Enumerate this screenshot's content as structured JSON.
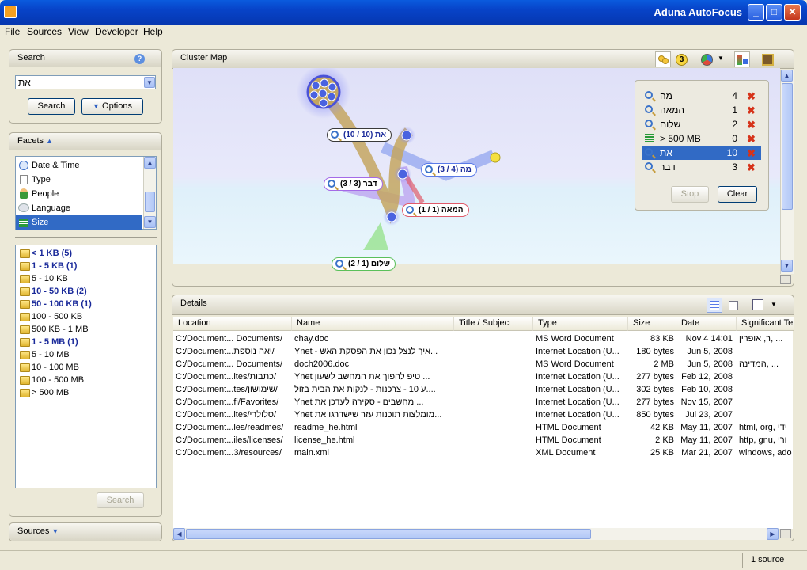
{
  "window": {
    "title": "Aduna AutoFocus",
    "min": "_",
    "max": "□",
    "close": "✕"
  },
  "menu": [
    "File",
    "Sources",
    "View",
    "Developer",
    "Help"
  ],
  "search": {
    "title": "Search",
    "value": "את",
    "search_btn": "Search",
    "options_btn": "Options"
  },
  "facets": {
    "title": "Facets",
    "items": [
      "Date & Time",
      "Type",
      "People",
      "Language",
      "Size"
    ],
    "selected": "Size",
    "values": [
      {
        "label": "< 1 KB  (5)",
        "bold": true
      },
      {
        "label": "1 - 5 KB  (1)",
        "bold": true
      },
      {
        "label": "5 - 10 KB",
        "bold": false
      },
      {
        "label": "10 - 50 KB  (2)",
        "bold": true
      },
      {
        "label": "50 - 100 KB  (1)",
        "bold": true
      },
      {
        "label": "100 - 500 KB",
        "bold": false
      },
      {
        "label": "500 KB - 1 MB",
        "bold": false
      },
      {
        "label": "1 - 5 MB  (1)",
        "bold": true
      },
      {
        "label": "5 - 10 MB",
        "bold": false
      },
      {
        "label": "10 - 100 MB",
        "bold": false
      },
      {
        "label": "100 - 500 MB",
        "bold": false
      },
      {
        "label": "> 500 MB",
        "bold": false
      }
    ],
    "search_btn": "Search"
  },
  "sources": {
    "title": "Sources"
  },
  "cluster_map": {
    "title": "Cluster Map",
    "badge": "3",
    "nodes": [
      {
        "label": "את (10 / 10)"
      },
      {
        "label": "מה (4 / 3)"
      },
      {
        "label": "דבר (3 / 3)"
      },
      {
        "label": "המאה (1 / 1)"
      },
      {
        "label": "שלום (1 / 2)"
      }
    ],
    "queries": [
      {
        "label": "מה",
        "count": "4",
        "selected": false
      },
      {
        "label": "המאה",
        "count": "1",
        "selected": false
      },
      {
        "label": "שלום",
        "count": "2",
        "selected": false
      },
      {
        "label": "> 500 MB",
        "count": "0",
        "selected": false
      },
      {
        "label": "את",
        "count": "10",
        "selected": true
      },
      {
        "label": "דבר",
        "count": "3",
        "selected": false
      }
    ],
    "stop_btn": "Stop",
    "clear_btn": "Clear"
  },
  "details": {
    "title": "Details",
    "columns": [
      "Location",
      "Name",
      "Title / Subject",
      "Type",
      "Size",
      "Date",
      "Significant Te"
    ],
    "rows": [
      [
        "C:/Document... Documents/",
        "chay.doc",
        "",
        "MS Word Document",
        "83 KB",
        "Nov 4  14:01",
        "ר, אופרין, ..."
      ],
      [
        "C:/Document...יאה נוספת/",
        "Ynet - איך לנצל נכון את הפסקת האש...",
        "",
        "Internet Location (U...",
        "180 bytes",
        "Jun 5, 2008",
        ""
      ],
      [
        "C:/Document... Documents/",
        "doch2006.doc",
        "",
        "MS Word Document",
        "2 MB",
        "Jun 5, 2008",
        "המדינה, ..."
      ],
      [
        "C:/Document...ites/כתבות/",
        "Ynet טיפ להפוך את המחשב לשעון ...",
        "",
        "Internet Location (U...",
        "277 bytes",
        "Feb 12, 2008",
        ""
      ],
      [
        "C:/Document...tes/שימושון/",
        "ע 10 - צרכנות - לנקות את הבית בזול....",
        "",
        "Internet Location (U...",
        "302 bytes",
        "Feb 10, 2008",
        ""
      ],
      [
        "C:/Document...fi/Favorites/",
        "Ynet מחשבים - סקירה לעדכן את ...",
        "",
        "Internet Location (U...",
        "277 bytes",
        "Nov 15, 2007",
        ""
      ],
      [
        "C:/Document...ites/סלולרי/",
        "Ynet מומלצות תוכנות עזר שישדרגו את...",
        "",
        "Internet Location (U...",
        "850 bytes",
        "Jul 23, 2007",
        ""
      ],
      [
        "C:/Document...les/readmes/",
        "readme_he.html",
        "",
        "HTML Document",
        "42 KB",
        "May 11, 2007",
        "html, org, ידי"
      ],
      [
        "C:/Document...iles/licenses/",
        "license_he.html",
        "",
        "HTML Document",
        "2 KB",
        "May 11, 2007",
        "http, gnu, ורי"
      ],
      [
        "C:/Document...3/resources/",
        "main.xml",
        "",
        "XML Document",
        "25 KB",
        "Mar 21, 2007",
        "windows, ado"
      ]
    ]
  },
  "status": {
    "sources": "1 source"
  }
}
